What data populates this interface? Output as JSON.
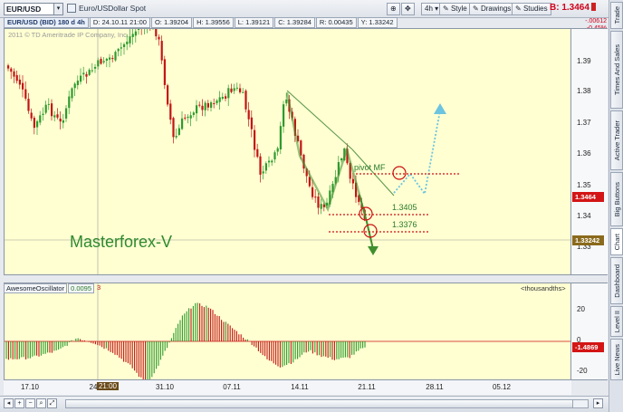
{
  "toolbar": {
    "symbol": "EUR/USD",
    "description": "Euro/USDollar Spot",
    "timeframe_label": "4h",
    "style_label": "Style",
    "drawings_label": "Drawings",
    "studies_label": "Studies",
    "bid_label": "B:",
    "bid_value": "1.3464",
    "change_abs": "-.00612",
    "change_pct": "-0.45%"
  },
  "infobar": {
    "title": "EUR/USD (BID) 180 d 4h",
    "date": "D: 24.10.11 21:00",
    "open": "O: 1.39204",
    "high": "H: 1.39556",
    "low": "L: 1.39121",
    "close": "C: 1.39284",
    "range": "R: 0.00435",
    "y": "Y: 1.33242"
  },
  "copyright": "2011 © TD Ameritrade IP Company, Inc.",
  "watermark": "Masterforex-V",
  "annotations": {
    "pivot_label": "pivot MF",
    "level1": "1.3405",
    "level2": "1.3376"
  },
  "yaxis": {
    "labels": [
      "1.39",
      "1.38",
      "1.37",
      "1.36",
      "1.35",
      "1.34",
      "1.33"
    ],
    "current_price": "1.3464",
    "cursor_price": "1.33242"
  },
  "oscillator": {
    "name": "AwesomeOscillator",
    "value": "0.0095",
    "param": "3",
    "units": "<thousandths>",
    "ylabels": [
      "20",
      "0",
      "-20"
    ],
    "current_value": "-1.4869"
  },
  "xaxis": {
    "labels": [
      "17.10",
      "24",
      "31.10",
      "07.11",
      "14.11",
      "21.11",
      "28.11",
      "05.12"
    ],
    "cursor_time": "21:00"
  },
  "side_tabs": [
    "Trade",
    "Times And Sales",
    "Active Trader",
    "Big Buttons",
    "Chart",
    "Dashboard",
    "Level II",
    "Live News"
  ],
  "colors": {
    "up": "#2e9a2e",
    "down": "#c21515",
    "chart_bg": "#ffffd2",
    "level_line": "#cc1111",
    "watermark": "#2f8a2f"
  }
}
